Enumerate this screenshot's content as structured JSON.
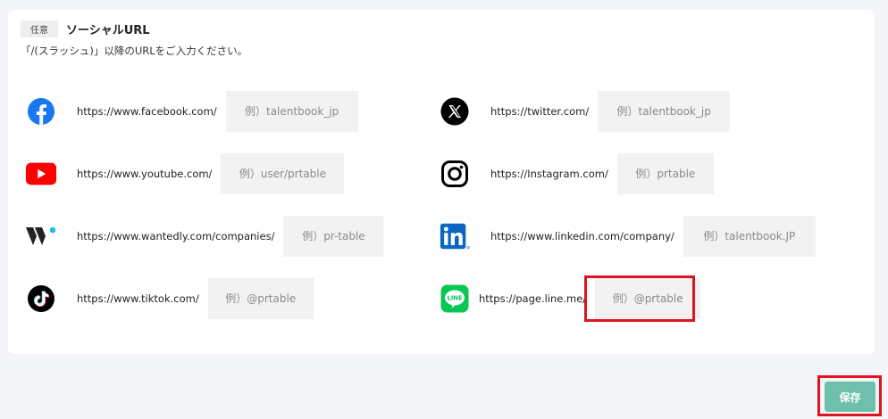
{
  "section": {
    "badge": "任意",
    "title": "ソーシャルURL",
    "description": "「/(スラッシュ)」以降のURLをご入力ください。"
  },
  "fields": {
    "facebook": {
      "prefix": "https://www.facebook.com/",
      "placeholder": "例）talentbook_jp",
      "icon": "facebook-icon",
      "color": "#1877f2"
    },
    "twitter": {
      "prefix": "https://twitter.com/",
      "placeholder": "例）talentbook_jp",
      "icon": "x-icon",
      "color": "#000000"
    },
    "youtube": {
      "prefix": "https://www.youtube.com/",
      "placeholder": "例）user/prtable",
      "icon": "youtube-icon",
      "color": "#ff0000"
    },
    "instagram": {
      "prefix": "https://Instagram.com/",
      "placeholder": "例）prtable",
      "icon": "instagram-icon",
      "color": "#000000"
    },
    "wantedly": {
      "prefix": "https://www.wantedly.com/companies/",
      "placeholder": "例）pr-table",
      "icon": "wantedly-icon",
      "color": "#21bddb"
    },
    "linkedin": {
      "prefix": "https://www.linkedin.com/company/",
      "placeholder": "例）talentbook.JP",
      "icon": "linkedin-icon",
      "color": "#0a66c2"
    },
    "tiktok": {
      "prefix": "https://www.tiktok.com/",
      "placeholder": "例）@prtable",
      "icon": "tiktok-icon",
      "color": "#000000"
    },
    "line": {
      "prefix": "https://page.line.me/",
      "placeholder": "例）@prtable",
      "icon": "line-icon",
      "color": "#06c755"
    }
  },
  "actions": {
    "save_label": "保存",
    "save_color": "#6ec0ac"
  },
  "highlight_color": "#e0141d"
}
